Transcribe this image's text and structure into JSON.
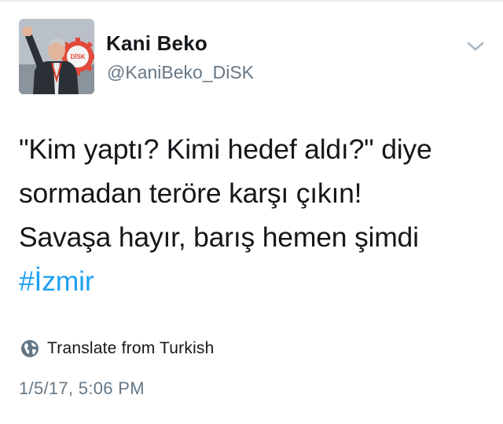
{
  "user": {
    "display_name": "Kani Beko",
    "handle": "@KaniBeko_DiSK",
    "avatar_badge": "DİSK"
  },
  "tweet": {
    "lines": [
      "\"Kim yaptı? Kimi hedef aldı?\" diye",
      "sormadan teröre karşı çıkın!",
      "Savaşa hayır, barış hemen şimdi"
    ],
    "hashtag": "#İzmir",
    "translate_label": "Translate from Turkish",
    "timestamp": "1/5/17, 5:06 PM"
  },
  "icons": {
    "caret": "chevron-down-icon",
    "translate": "globe-icon"
  },
  "colors": {
    "text": "#14171a",
    "secondary": "#657786",
    "link": "#1da1f2",
    "caret": "#aab8c2"
  }
}
